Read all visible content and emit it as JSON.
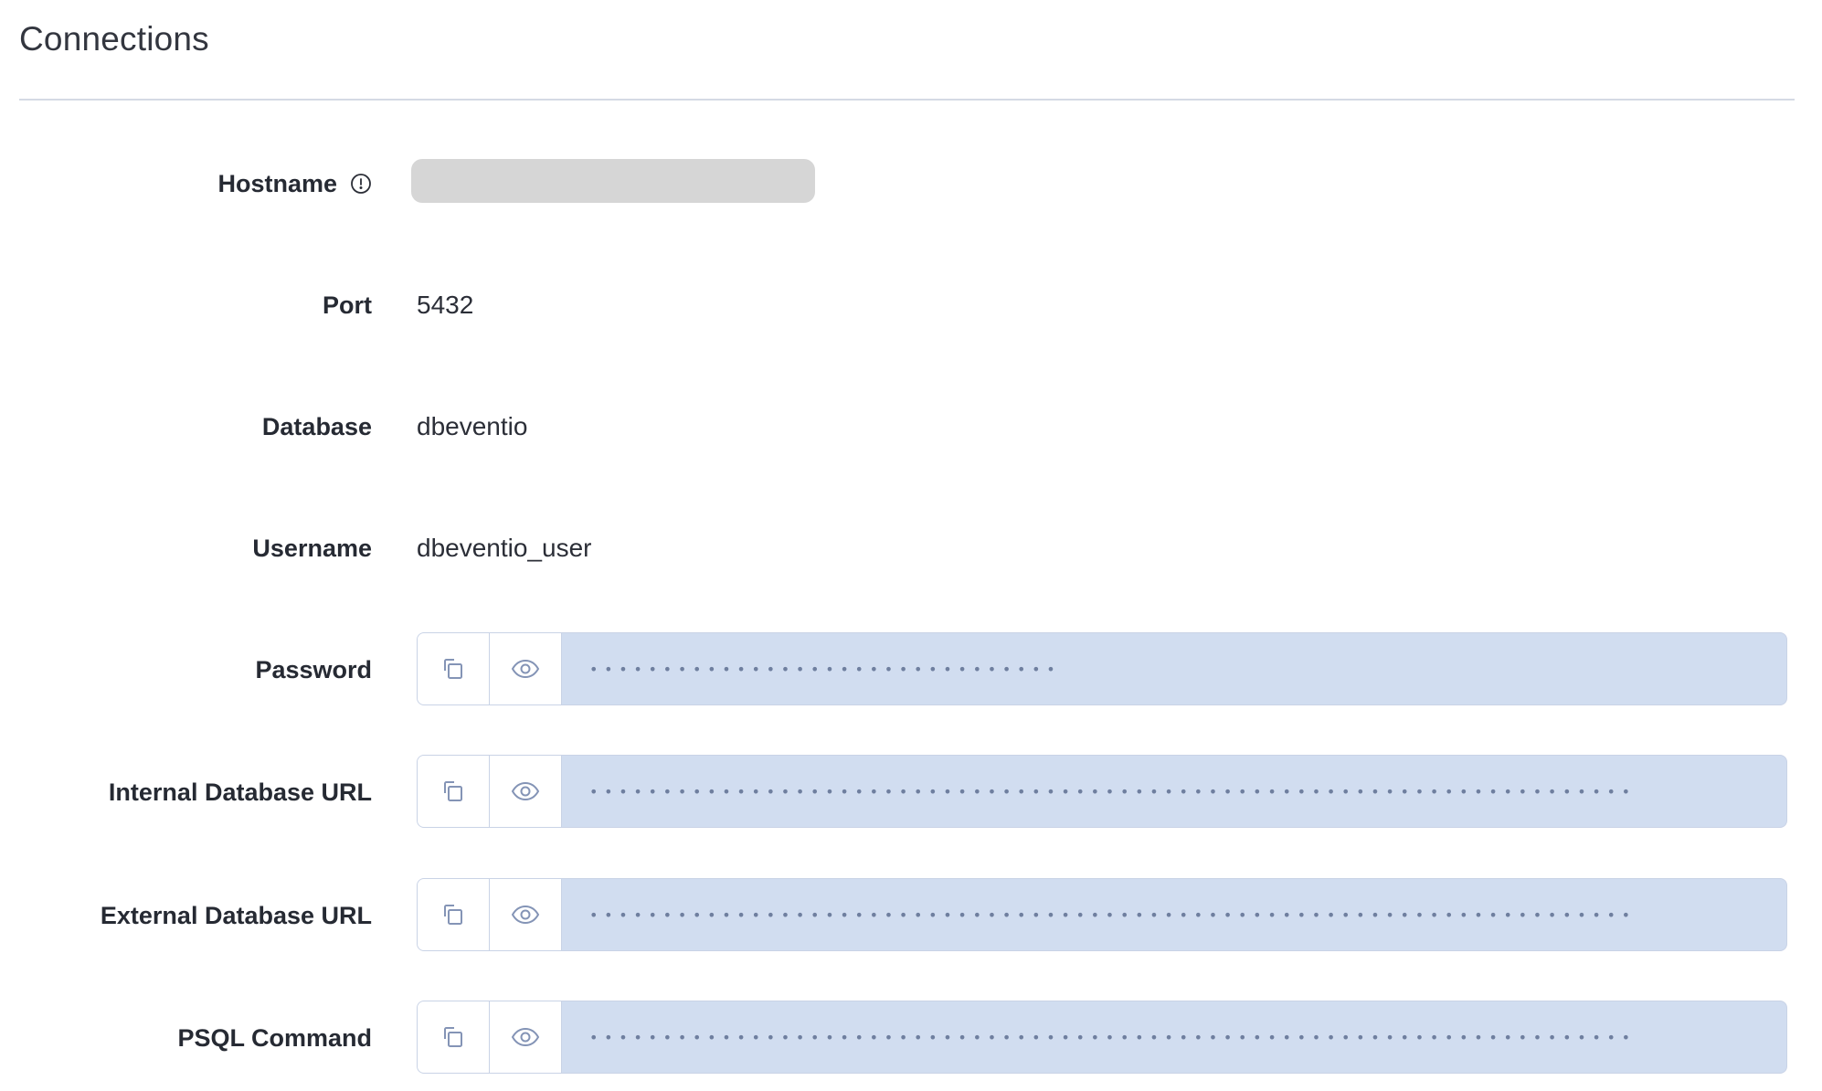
{
  "section": {
    "title": "Connections"
  },
  "fields": {
    "hostname": {
      "label": "Hostname",
      "icon": "info-circle-icon"
    },
    "port": {
      "label": "Port",
      "value": "5432"
    },
    "database": {
      "label": "Database",
      "value": "dbeventio"
    },
    "username": {
      "label": "Username",
      "value": "dbeventio_user"
    },
    "password": {
      "label": "Password",
      "masked": "••••••••••••••••••••••••••••••••"
    },
    "internal_url": {
      "label": "Internal Database URL",
      "masked": "•••••••••••••••••••••••••••••••••••••••••••••••••••••••••••••••••••••••"
    },
    "external_url": {
      "label": "External Database URL",
      "masked": "•••••••••••••••••••••••••••••••••••••••••••••••••••••••••••••••••••••••"
    },
    "psql_command": {
      "label": "PSQL Command",
      "masked": "•••••••••••••••••••••••••••••••••••••••••••••••••••••••••••••••••••••••"
    }
  },
  "icons": {
    "copy": "copy-icon",
    "reveal": "eye-icon"
  },
  "colors": {
    "secret_background": "#d1ddf0",
    "secret_border": "#c9d3e6",
    "icon_color": "#8494b6",
    "divider": "#d4dae4"
  }
}
